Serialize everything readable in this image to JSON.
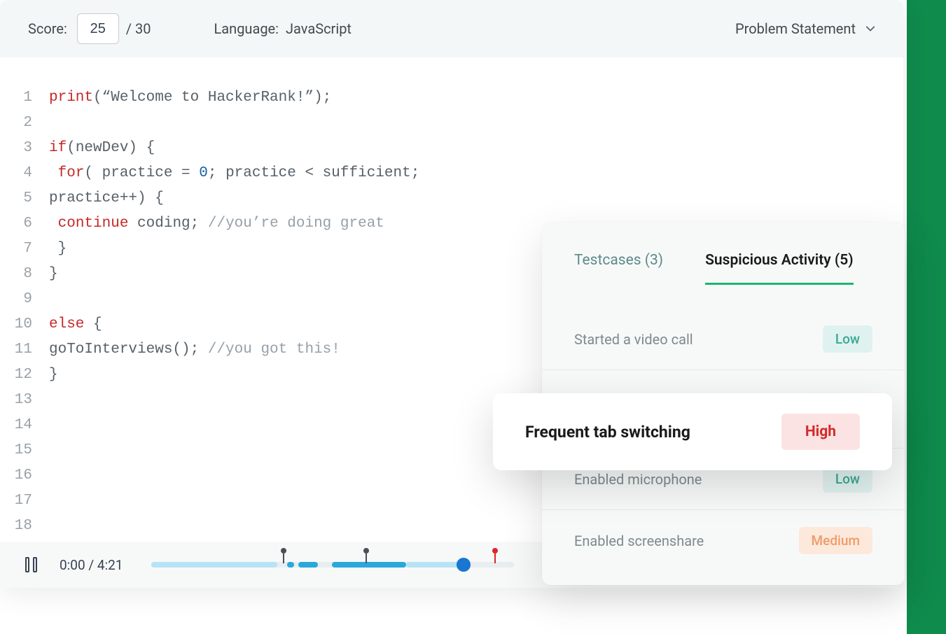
{
  "header": {
    "score_label": "Score:",
    "score_value": "25",
    "score_max": "/ 30",
    "language_label": "Language:",
    "language_value": "JavaScript",
    "dropdown_label": "Problem Statement"
  },
  "code": {
    "lines": [
      {
        "n": 1,
        "tokens": [
          {
            "t": "print",
            "c": "k"
          },
          {
            "t": "(“Welcome to HackerRank!”);",
            "c": "p"
          }
        ]
      },
      {
        "n": 2,
        "tokens": []
      },
      {
        "n": 3,
        "tokens": [
          {
            "t": "if",
            "c": "k"
          },
          {
            "t": "(newDev) {",
            "c": "p"
          }
        ]
      },
      {
        "n": 4,
        "tokens": [
          {
            "t": " ",
            "c": "p"
          },
          {
            "t": "for",
            "c": "k"
          },
          {
            "t": "( practice = ",
            "c": "p"
          },
          {
            "t": "0",
            "c": "n"
          },
          {
            "t": "; practice < sufficient;",
            "c": "p"
          }
        ]
      },
      {
        "n": 5,
        "tokens": [
          {
            "t": "practice++) {",
            "c": "p"
          }
        ]
      },
      {
        "n": 6,
        "tokens": [
          {
            "t": " ",
            "c": "p"
          },
          {
            "t": "continue",
            "c": "k"
          },
          {
            "t": " coding; ",
            "c": "p"
          },
          {
            "t": "//you’re doing great",
            "c": "c"
          }
        ]
      },
      {
        "n": 7,
        "tokens": [
          {
            "t": " }",
            "c": "p"
          }
        ]
      },
      {
        "n": 8,
        "tokens": [
          {
            "t": "}",
            "c": "p"
          }
        ]
      },
      {
        "n": 9,
        "tokens": []
      },
      {
        "n": 10,
        "tokens": [
          {
            "t": "else",
            "c": "k"
          },
          {
            "t": " {",
            "c": "p"
          }
        ]
      },
      {
        "n": 11,
        "tokens": [
          {
            "t": "goToInterviews(); ",
            "c": "p"
          },
          {
            "t": "//you got this!",
            "c": "c"
          }
        ]
      },
      {
        "n": 12,
        "tokens": [
          {
            "t": "}",
            "c": "p"
          }
        ]
      },
      {
        "n": 13,
        "tokens": []
      },
      {
        "n": 14,
        "tokens": []
      },
      {
        "n": 15,
        "tokens": []
      },
      {
        "n": 16,
        "tokens": []
      },
      {
        "n": 17,
        "tokens": []
      },
      {
        "n": 18,
        "tokens": []
      }
    ]
  },
  "playback": {
    "current_time": "0:00",
    "total_time": "4:21",
    "time_display": "0:00 / 4:21"
  },
  "panel": {
    "tabs": [
      {
        "label": "Testcases (3)",
        "active": false
      },
      {
        "label": "Suspicious Activity (5)",
        "active": true
      }
    ],
    "activities": [
      {
        "label": "Started a video call",
        "level": "Low",
        "level_class": "low"
      },
      {
        "label": "Frequent tab switching",
        "level": "High",
        "level_class": "high"
      },
      {
        "label": "Enabled microphone",
        "level": "Low",
        "level_class": "low"
      },
      {
        "label": "Enabled screenshare",
        "level": "Medium",
        "level_class": "medium"
      }
    ]
  }
}
